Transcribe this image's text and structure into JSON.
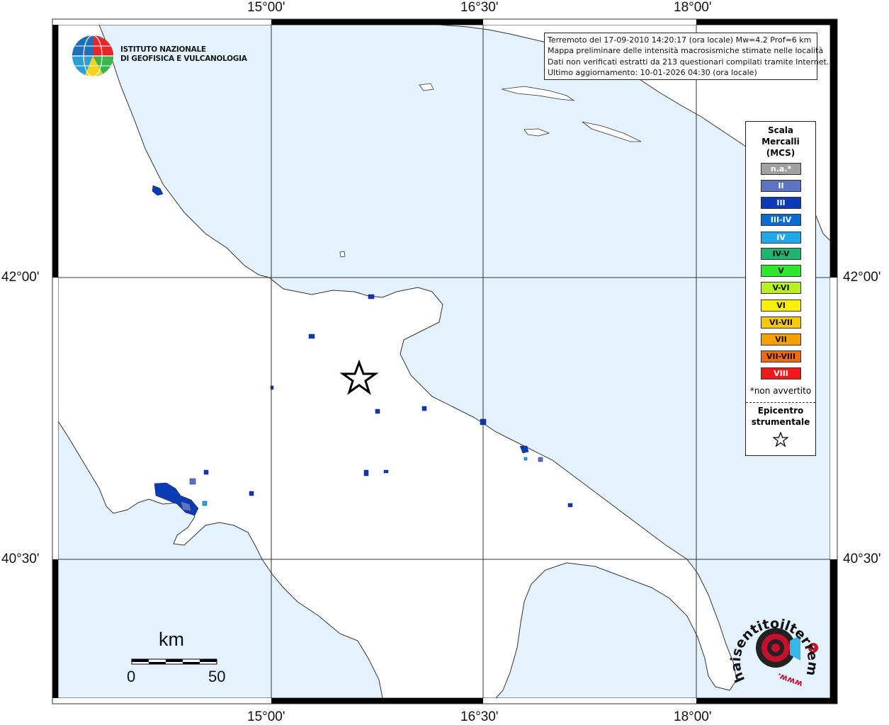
{
  "info": {
    "line1": "Terremoto del 17-09-2010 14:20:17 (ora locale) Mw=4.2 Prof=6 km",
    "line2": "Mappa preliminare delle intensità macrosismiche stimate nelle località",
    "line3": "Dati non verificati estratti da 213 questionari compilati tramite Internet.",
    "line4": "Ultimo aggiornamento: 10-01-2026 04:30 (ora locale)"
  },
  "logo": {
    "line1": "ISTITUTO NAZIONALE",
    "line2": "DI GEOFISICA E VULCANOLOGIA"
  },
  "ticks": {
    "top": [
      "15°00'",
      "16°30'",
      "18°00'"
    ],
    "bottom": [
      "15°00'",
      "16°30'",
      "18°00'"
    ],
    "left": [
      "42°00'",
      "40°30'"
    ],
    "right": [
      "42°00'",
      "40°30'"
    ]
  },
  "legend": {
    "title1": "Scala",
    "title2": "Mercalli",
    "title3": "(MCS)",
    "items": [
      {
        "label": "n.a.*",
        "color": "#a0a0a0"
      },
      {
        "label": "II",
        "color": "#5a74c2"
      },
      {
        "label": "III",
        "color": "#0a3ab4"
      },
      {
        "label": "III-IV",
        "color": "#0a6bd0"
      },
      {
        "label": "IV",
        "color": "#20a8e8"
      },
      {
        "label": "IV-V",
        "color": "#1fb56e"
      },
      {
        "label": "V",
        "color": "#2ee82e"
      },
      {
        "label": "V-VI",
        "color": "#b8f020"
      },
      {
        "label": "VI",
        "color": "#f8f000"
      },
      {
        "label": "VI-VII",
        "color": "#f8c800"
      },
      {
        "label": "VII",
        "color": "#f8a000"
      },
      {
        "label": "VII-VIII",
        "color": "#f06a10"
      },
      {
        "label": "VIII",
        "color": "#f01818"
      }
    ],
    "note": "*non avvertito",
    "epi1": "Epicentro",
    "epi2": "strumentale"
  },
  "scalebar": {
    "title": "km",
    "min": "0",
    "max": "50"
  },
  "hst": {
    "text": "haisentitoilterremoto.it",
    "www": "www."
  },
  "colors": {
    "sea": "#e3f2fc",
    "land": "#ffffff"
  }
}
